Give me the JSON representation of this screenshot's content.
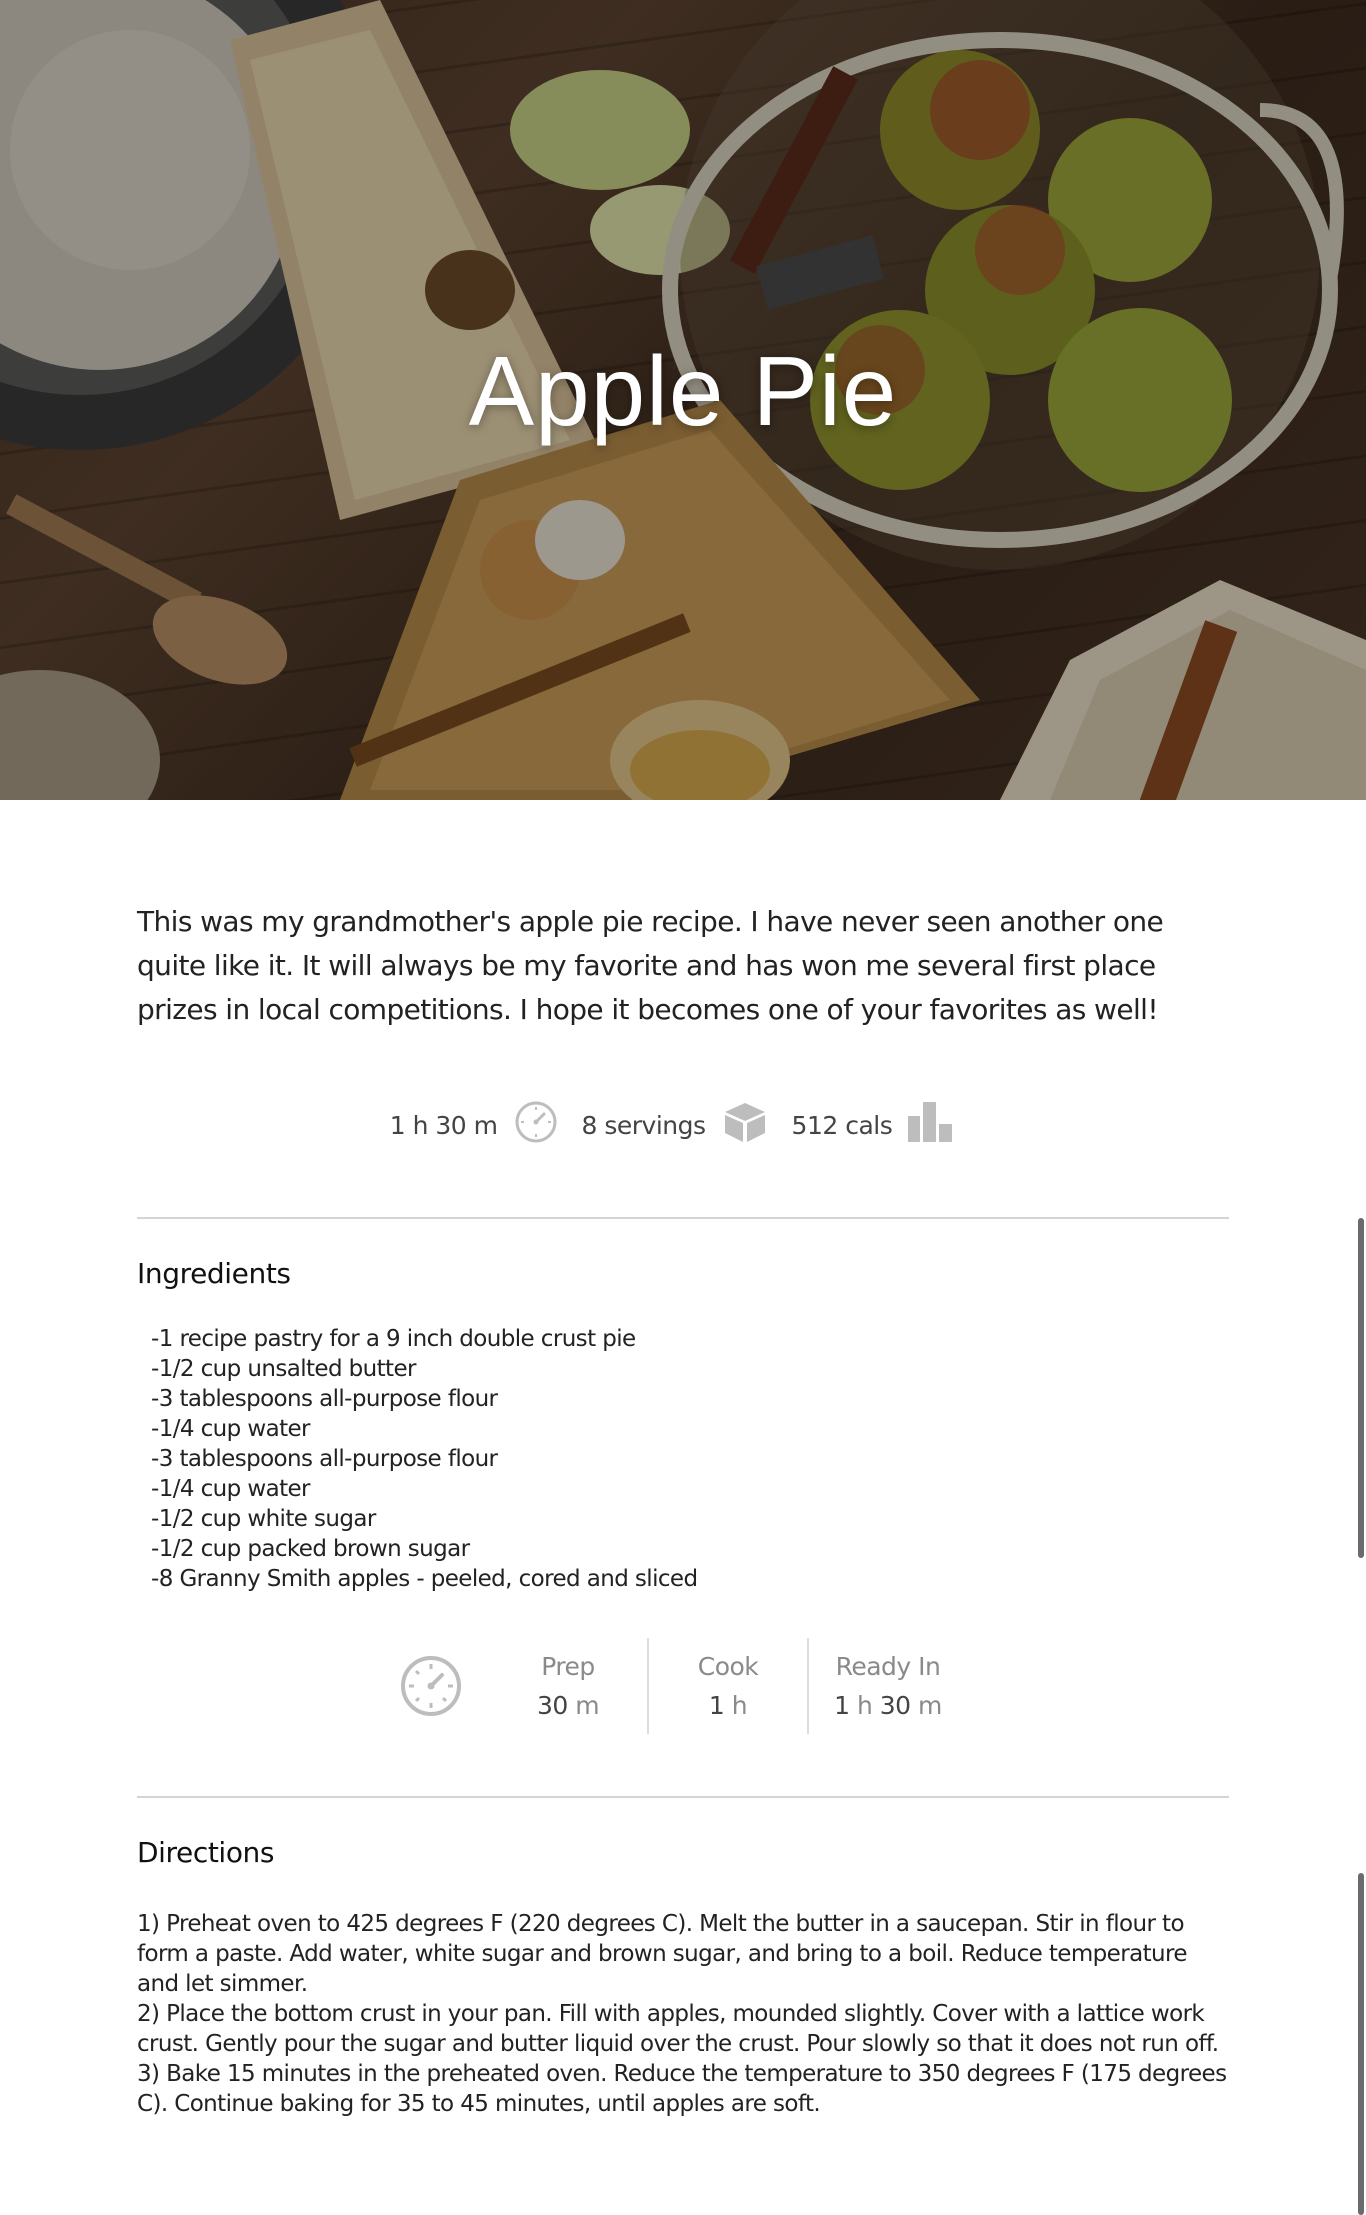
{
  "hero": {
    "title": "Apple Pie"
  },
  "intro": "This was my grandmother's apple pie recipe. I have never seen another one quite like it. It will always be my favorite and has won me several first place prizes in local competitions. I hope it becomes one of your favorites as well!",
  "stats": {
    "time": "1 h 30 m",
    "time_icon": "clock-icon",
    "servings": "8 servings",
    "servings_icon": "pie-icon",
    "calories": "512 cals",
    "calories_icon": "bar-chart-icon"
  },
  "ingredients": {
    "title": "Ingredients",
    "items": [
      "-1 recipe pastry for a 9 inch double crust pie",
      "-1/2 cup unsalted butter",
      "-3 tablespoons all-purpose flour",
      "-1/4 cup water",
      "-3 tablespoons all-purpose flour",
      "-1/4 cup water",
      "-1/2 cup white sugar",
      "-1/2 cup packed brown sugar",
      "-8 Granny Smith apples - peeled, cored and sliced"
    ]
  },
  "times": {
    "icon": "clock-icon",
    "prep": {
      "label": "Prep",
      "value": "30",
      "unit": "m"
    },
    "cook": {
      "label": "Cook",
      "value": "1",
      "unit": "h"
    },
    "ready": {
      "label": "Ready In",
      "hours": "1",
      "hours_unit": "h",
      "minutes": "30",
      "minutes_unit": "m"
    }
  },
  "directions": {
    "title": "Directions",
    "steps": [
      "1) Preheat oven to 425 degrees F (220 degrees C). Melt the butter in a saucepan. Stir in flour to form a paste. Add water, white sugar and brown sugar, and bring to a boil. Reduce temperature and let simmer.",
      "2) Place the bottom crust in your pan. Fill with apples, mounded slightly. Cover with a lattice work crust. Gently pour the sugar and butter liquid over the crust. Pour slowly so that it does not run off.",
      "3) Bake 15 minutes in the preheated oven. Reduce the temperature to 350 degrees F (175 degrees C). Continue baking for 35 to 45 minutes, until apples are soft."
    ]
  },
  "colors": {
    "icon_gray": "#bdbdbd",
    "divider": "#d4d4d4"
  }
}
